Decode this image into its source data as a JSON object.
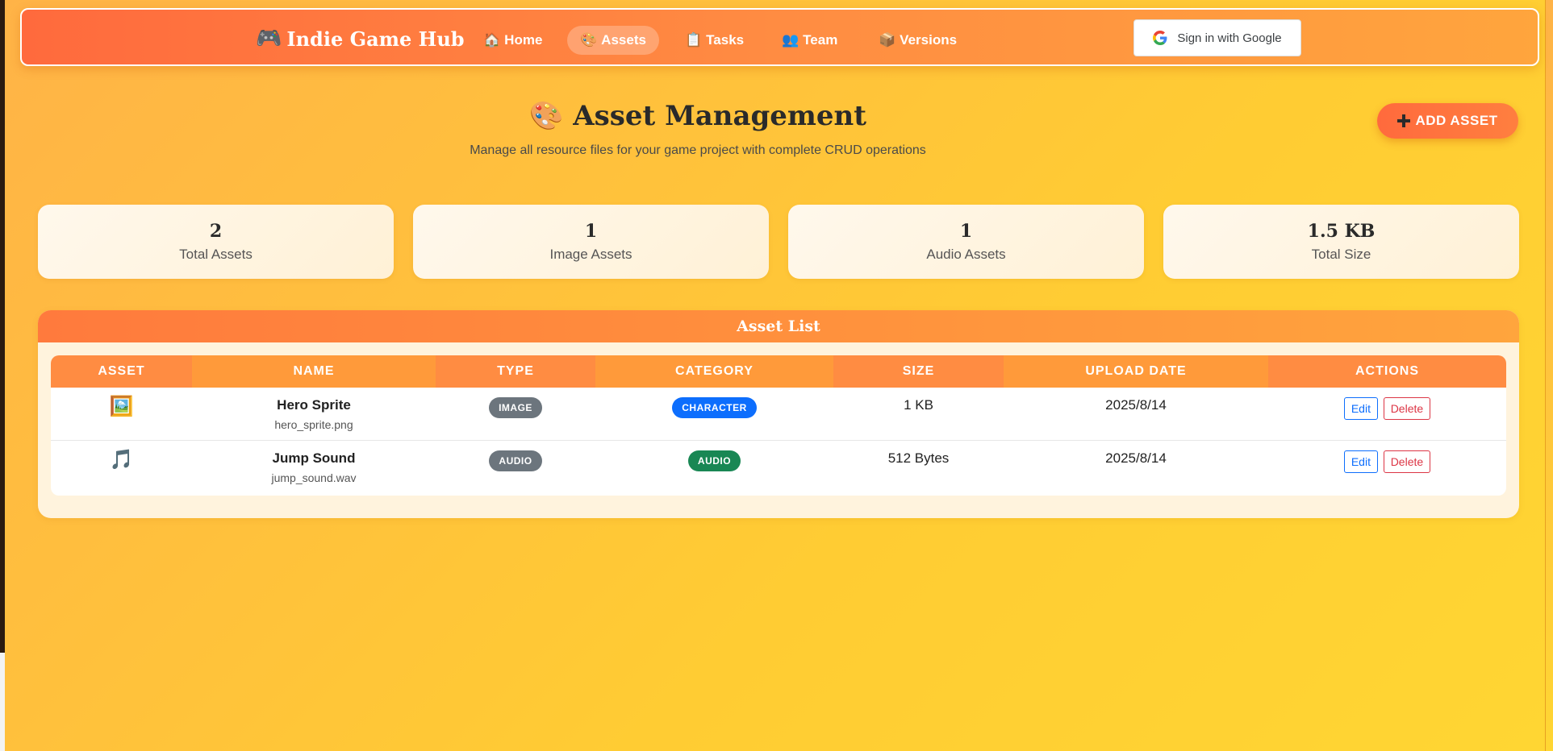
{
  "nav": {
    "brand_icon": "🎮",
    "brand": "Indie Game Hub",
    "links": [
      {
        "icon": "🏠",
        "label": "Home"
      },
      {
        "icon": "🎨",
        "label": "Assets"
      },
      {
        "icon": "📋",
        "label": "Tasks"
      },
      {
        "icon": "👥",
        "label": "Team"
      },
      {
        "icon": "📦",
        "label": "Versions"
      }
    ],
    "active": "Assets",
    "google_label": "Sign in with Google"
  },
  "header": {
    "icon": "🎨",
    "title": "Asset Management",
    "subtitle": "Manage all resource files for your game project with complete CRUD operations",
    "add_label": "ADD ASSET"
  },
  "stats": [
    {
      "value": "2",
      "label": "Total Assets"
    },
    {
      "value": "1",
      "label": "Image Assets"
    },
    {
      "value": "1",
      "label": "Audio Assets"
    },
    {
      "value": "1.5 KB",
      "label": "Total Size"
    }
  ],
  "asset_list": {
    "title": "Asset List",
    "columns": [
      "ASSET",
      "NAME",
      "TYPE",
      "CATEGORY",
      "SIZE",
      "UPLOAD DATE",
      "ACTIONS"
    ],
    "rows": [
      {
        "icon": "🖼️",
        "name": "Hero Sprite",
        "file": "hero_sprite.png",
        "type": "IMAGE",
        "category": "CHARACTER",
        "size": "1 KB",
        "date": "2025/8/14",
        "edit": "Edit",
        "delete": "Delete"
      },
      {
        "icon": "🎵",
        "name": "Jump Sound",
        "file": "jump_sound.wav",
        "type": "AUDIO",
        "category": "AUDIO",
        "size": "512 Bytes",
        "date": "2025/8/14",
        "edit": "Edit",
        "delete": "Delete"
      }
    ]
  },
  "colors": {
    "nav_start": "#ff6a3d",
    "nav_end": "#ffa53d",
    "background": "#ffcc33",
    "badge_gray": "#6c757d",
    "badge_blue": "#0d6efd",
    "badge_green": "#198754",
    "edit": "#0d6efd",
    "delete": "#dc3545"
  }
}
